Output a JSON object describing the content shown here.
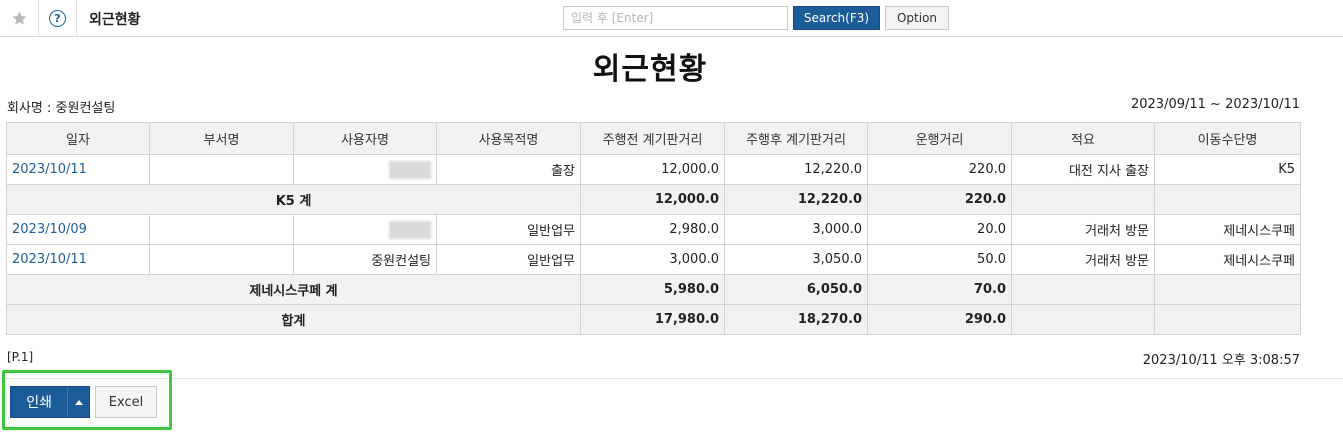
{
  "toolbar": {
    "title": "외근현황",
    "search_placeholder": "입력 후 [Enter]",
    "search_button": "Search(F3)",
    "option_button": "Option",
    "star_icon": "star-icon",
    "help_icon": "help-icon",
    "help_glyph": "?"
  },
  "report": {
    "title": "외근현황",
    "company": "회사명 : 중원컨설팅",
    "period": "2023/09/11 ~ 2023/10/11",
    "columns": [
      "일자",
      "부서명",
      "사용자명",
      "사용목적명",
      "주행전 계기판거리",
      "주행후 계기판거리",
      "운행거리",
      "적요",
      "이동수단명"
    ],
    "rows": [
      {
        "date": "2023/10/11",
        "dept": "",
        "user": "",
        "purpose": "출장",
        "before": "12,000.0",
        "after": "12,220.0",
        "distance": "220.0",
        "memo": "대전 지사 출장",
        "vehicle": "K5"
      },
      {
        "subtotal": true,
        "label": "K5 계",
        "before": "12,000.0",
        "after": "12,220.0",
        "distance": "220.0"
      },
      {
        "date": "2023/10/09",
        "dept": "",
        "user": "",
        "purpose": "일반업무",
        "before": "2,980.0",
        "after": "3,000.0",
        "distance": "20.0",
        "memo": "거래처 방문",
        "vehicle": "제네시스쿠페"
      },
      {
        "date": "2023/10/11",
        "dept": "",
        "user": "중원컨설팅",
        "purpose": "일반업무",
        "before": "3,000.0",
        "after": "3,050.0",
        "distance": "50.0",
        "memo": "거래처 방문",
        "vehicle": "제네시스쿠페"
      },
      {
        "subtotal": true,
        "label": "제네시스쿠페 계",
        "before": "5,980.0",
        "after": "6,050.0",
        "distance": "70.0"
      },
      {
        "subtotal": true,
        "label": "합계",
        "before": "17,980.0",
        "after": "18,270.0",
        "distance": "290.0"
      }
    ],
    "page_no": "[P.1]",
    "timestamp": "2023/10/11 오후 3:08:57"
  },
  "footer": {
    "print_button": "인쇄",
    "excel_button": "Excel",
    "highlight_color": "#3ec93e",
    "primary_color": "#1c5d99"
  }
}
